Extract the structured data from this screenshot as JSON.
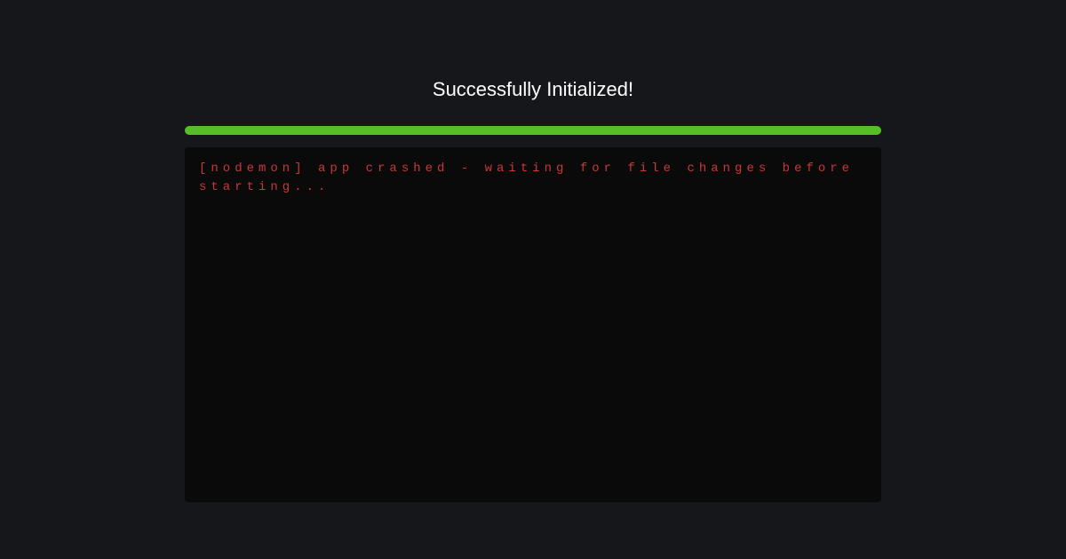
{
  "header": {
    "title": "Successfully Initialized!"
  },
  "progress": {
    "percent": 100,
    "color": "#54c026"
  },
  "terminal": {
    "output": "[nodemon] app crashed - waiting for file changes before starting...",
    "text_color": "#c93838",
    "background": "#0a0a0a"
  }
}
